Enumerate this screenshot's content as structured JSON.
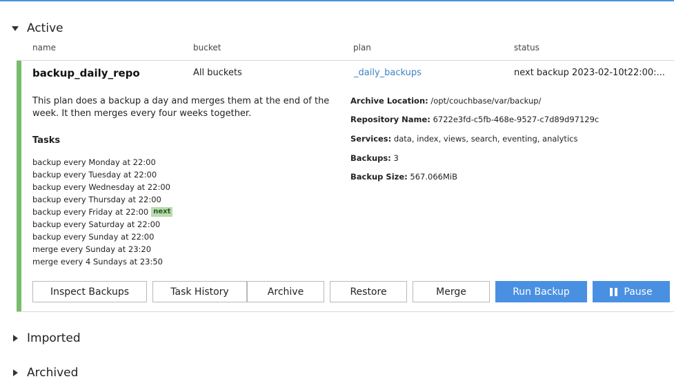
{
  "sections": {
    "active": "Active",
    "imported": "Imported",
    "archived": "Archived"
  },
  "columns": {
    "name": "name",
    "bucket": "bucket",
    "plan": "plan",
    "status": "status"
  },
  "repo": {
    "name": "backup_daily_repo",
    "bucket": "All buckets",
    "plan": "_daily_backups",
    "status": "next backup 2023-02-10t22:00:...",
    "description": "This plan does a backup a day and merges them at the end of the week. It then merges every four weeks together.",
    "tasks_title": "Tasks",
    "tasks": [
      "backup every Monday at 22:00",
      "backup every Tuesday at 22:00",
      "backup every Wednesday at 22:00",
      "backup every Thursday at 22:00",
      "backup every Friday at 22:00",
      "backup every Saturday at 22:00",
      "backup every Sunday at 22:00",
      "merge every Sunday at 23:20",
      "merge every 4 Sundays at 23:50"
    ],
    "next_badge": "next",
    "info": {
      "archive_location_label": "Archive Location:",
      "archive_location": "/opt/couchbase/var/backup/",
      "repository_name_label": "Repository Name:",
      "repository_name": "6722e3fd-c5fb-468e-9527-c7d89d97129c",
      "services_label": "Services:",
      "services": "data, index, views, search, eventing, analytics",
      "backups_label": "Backups:",
      "backups": "3",
      "backup_size_label": "Backup Size:",
      "backup_size": "567.066MiB"
    }
  },
  "buttons": {
    "inspect": "Inspect Backups",
    "history": "Task History",
    "archive": "Archive",
    "restore": "Restore",
    "merge": "Merge",
    "run": "Run Backup",
    "pause": "Pause"
  },
  "colors": {
    "accent": "#4a90e2",
    "link": "#3b82c4",
    "active_bar": "#79bc6b",
    "next_badge_bg": "#b9dcae"
  }
}
